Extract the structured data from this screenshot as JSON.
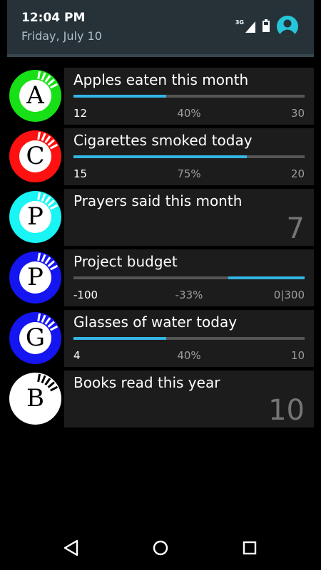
{
  "status": {
    "time": "12:04 PM",
    "date": "Friday, July 10",
    "network": "3G"
  },
  "items": [
    {
      "letter": "A",
      "color": "#17e016",
      "title": "Apples eaten this month",
      "type": "progress",
      "min": "12",
      "percent": "40%",
      "max": "30",
      "fill_start": 0,
      "fill_end": 0.4
    },
    {
      "letter": "C",
      "color": "#ff1111",
      "title": "Cigarettes smoked today",
      "type": "progress",
      "min": "15",
      "percent": "75%",
      "max": "20",
      "fill_start": 0,
      "fill_end": 0.75
    },
    {
      "letter": "P",
      "color": "#19f4f4",
      "title": "Prayers said this month",
      "type": "count",
      "count": "7"
    },
    {
      "letter": "P",
      "color": "#1515f2",
      "title": "Project budget",
      "type": "progress",
      "min": "-100",
      "percent": "-33%",
      "max": "0|300",
      "fill_start": 0.67,
      "fill_end": 1.0
    },
    {
      "letter": "G",
      "color": "#1515f2",
      "title": "Glasses of water today",
      "type": "progress",
      "min": "4",
      "percent": "40%",
      "max": "10",
      "fill_start": 0,
      "fill_end": 0.4
    },
    {
      "letter": "B",
      "color": "#ffffff",
      "title": "Books read this year",
      "type": "count",
      "count": "10"
    }
  ],
  "colors": {
    "accent": "#33b5e5",
    "track": "#555555",
    "card": "#1c1c1c"
  },
  "nav": {
    "back_icon": "back-triangle-icon",
    "home_icon": "home-circle-icon",
    "recents_icon": "recents-square-icon"
  }
}
